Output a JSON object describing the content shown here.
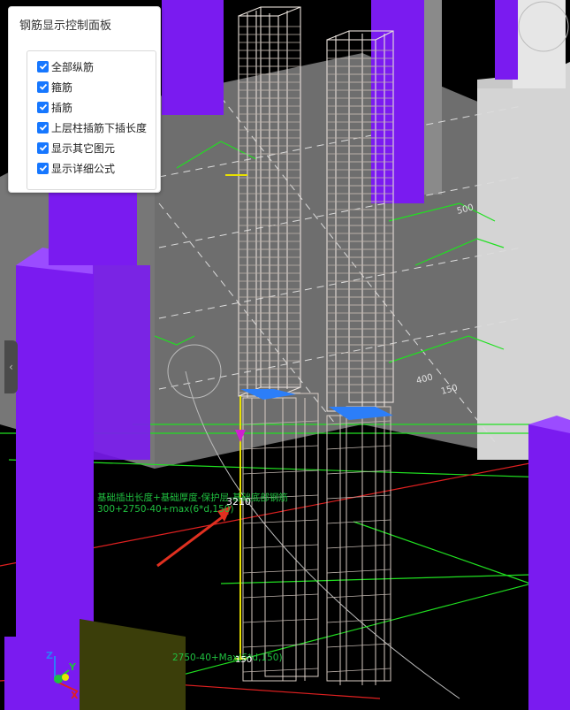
{
  "panel": {
    "title": "钢筋显示控制面板",
    "options": [
      {
        "label": "全部纵筋",
        "checked": true
      },
      {
        "label": "箍筋",
        "checked": true
      },
      {
        "label": "插筋",
        "checked": true
      },
      {
        "label": "上层柱插筋下插长度",
        "checked": true
      },
      {
        "label": "显示其它图元",
        "checked": true
      },
      {
        "label": "显示详细公式",
        "checked": true
      }
    ]
  },
  "viewport": {
    "formula_line1": "基础插出长度+基础厚度-保护层-基础底部钢筋",
    "formula_line2": "300+2750-40+max(6*d,150)",
    "dimension_value": "3210",
    "bottom_formula": "2750-40+Max(6*d,150)",
    "bottom_value": "150",
    "dims": [
      "400",
      "150",
      "500"
    ],
    "axis_labels": {
      "x": "X",
      "y": "Y",
      "z": "Z"
    },
    "colors": {
      "column": "#7a1bf0",
      "slab": "#7a7a7a",
      "wall": "#d8d8d8",
      "rebar": "#e8e0da",
      "grid_green": "#20e020",
      "grid_red": "#e02020",
      "arrow": "#e03020",
      "dimension": "#e8e000",
      "formula": "#20c040",
      "bottom_patch": "#3b3e0a",
      "accent": "#1677ff"
    }
  }
}
